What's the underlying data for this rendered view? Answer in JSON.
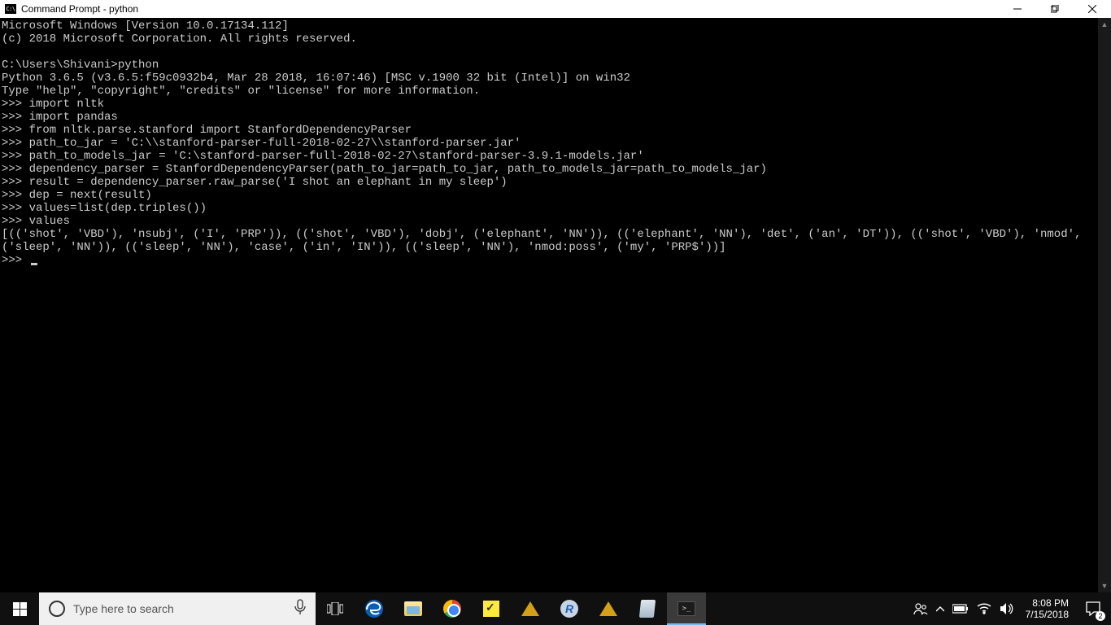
{
  "titlebar": {
    "icon_label": "C:\\",
    "title": "Command Prompt - python"
  },
  "console": {
    "lines": [
      "Microsoft Windows [Version 10.0.17134.112]",
      "(c) 2018 Microsoft Corporation. All rights reserved.",
      "",
      "C:\\Users\\Shivani>python",
      "Python 3.6.5 (v3.6.5:f59c0932b4, Mar 28 2018, 16:07:46) [MSC v.1900 32 bit (Intel)] on win32",
      "Type \"help\", \"copyright\", \"credits\" or \"license\" for more information.",
      ">>> import nltk",
      ">>> import pandas",
      ">>> from nltk.parse.stanford import StanfordDependencyParser",
      ">>> path_to_jar = 'C:\\\\stanford-parser-full-2018-02-27\\\\stanford-parser.jar'",
      ">>> path_to_models_jar = 'C:\\stanford-parser-full-2018-02-27\\stanford-parser-3.9.1-models.jar'",
      ">>> dependency_parser = StanfordDependencyParser(path_to_jar=path_to_jar, path_to_models_jar=path_to_models_jar)",
      ">>> result = dependency_parser.raw_parse('I shot an elephant in my sleep')",
      ">>> dep = next(result)",
      ">>> values=list(dep.triples())",
      ">>> values",
      "[(('shot', 'VBD'), 'nsubj', ('I', 'PRP')), (('shot', 'VBD'), 'dobj', ('elephant', 'NN')), (('elephant', 'NN'), 'det', ('an', 'DT')), (('shot', 'VBD'), 'nmod', ('sleep', 'NN')), (('sleep', 'NN'), 'case', ('in', 'IN')), (('sleep', 'NN'), 'nmod:poss', ('my', 'PRP$'))]"
    ],
    "prompt": ">>> "
  },
  "taskbar": {
    "search_placeholder": "Type here to search",
    "r_label": "R",
    "cmd_label": ">_",
    "clock_time": "8:08 PM",
    "clock_date": "7/15/2018",
    "notif_badge": "2"
  }
}
